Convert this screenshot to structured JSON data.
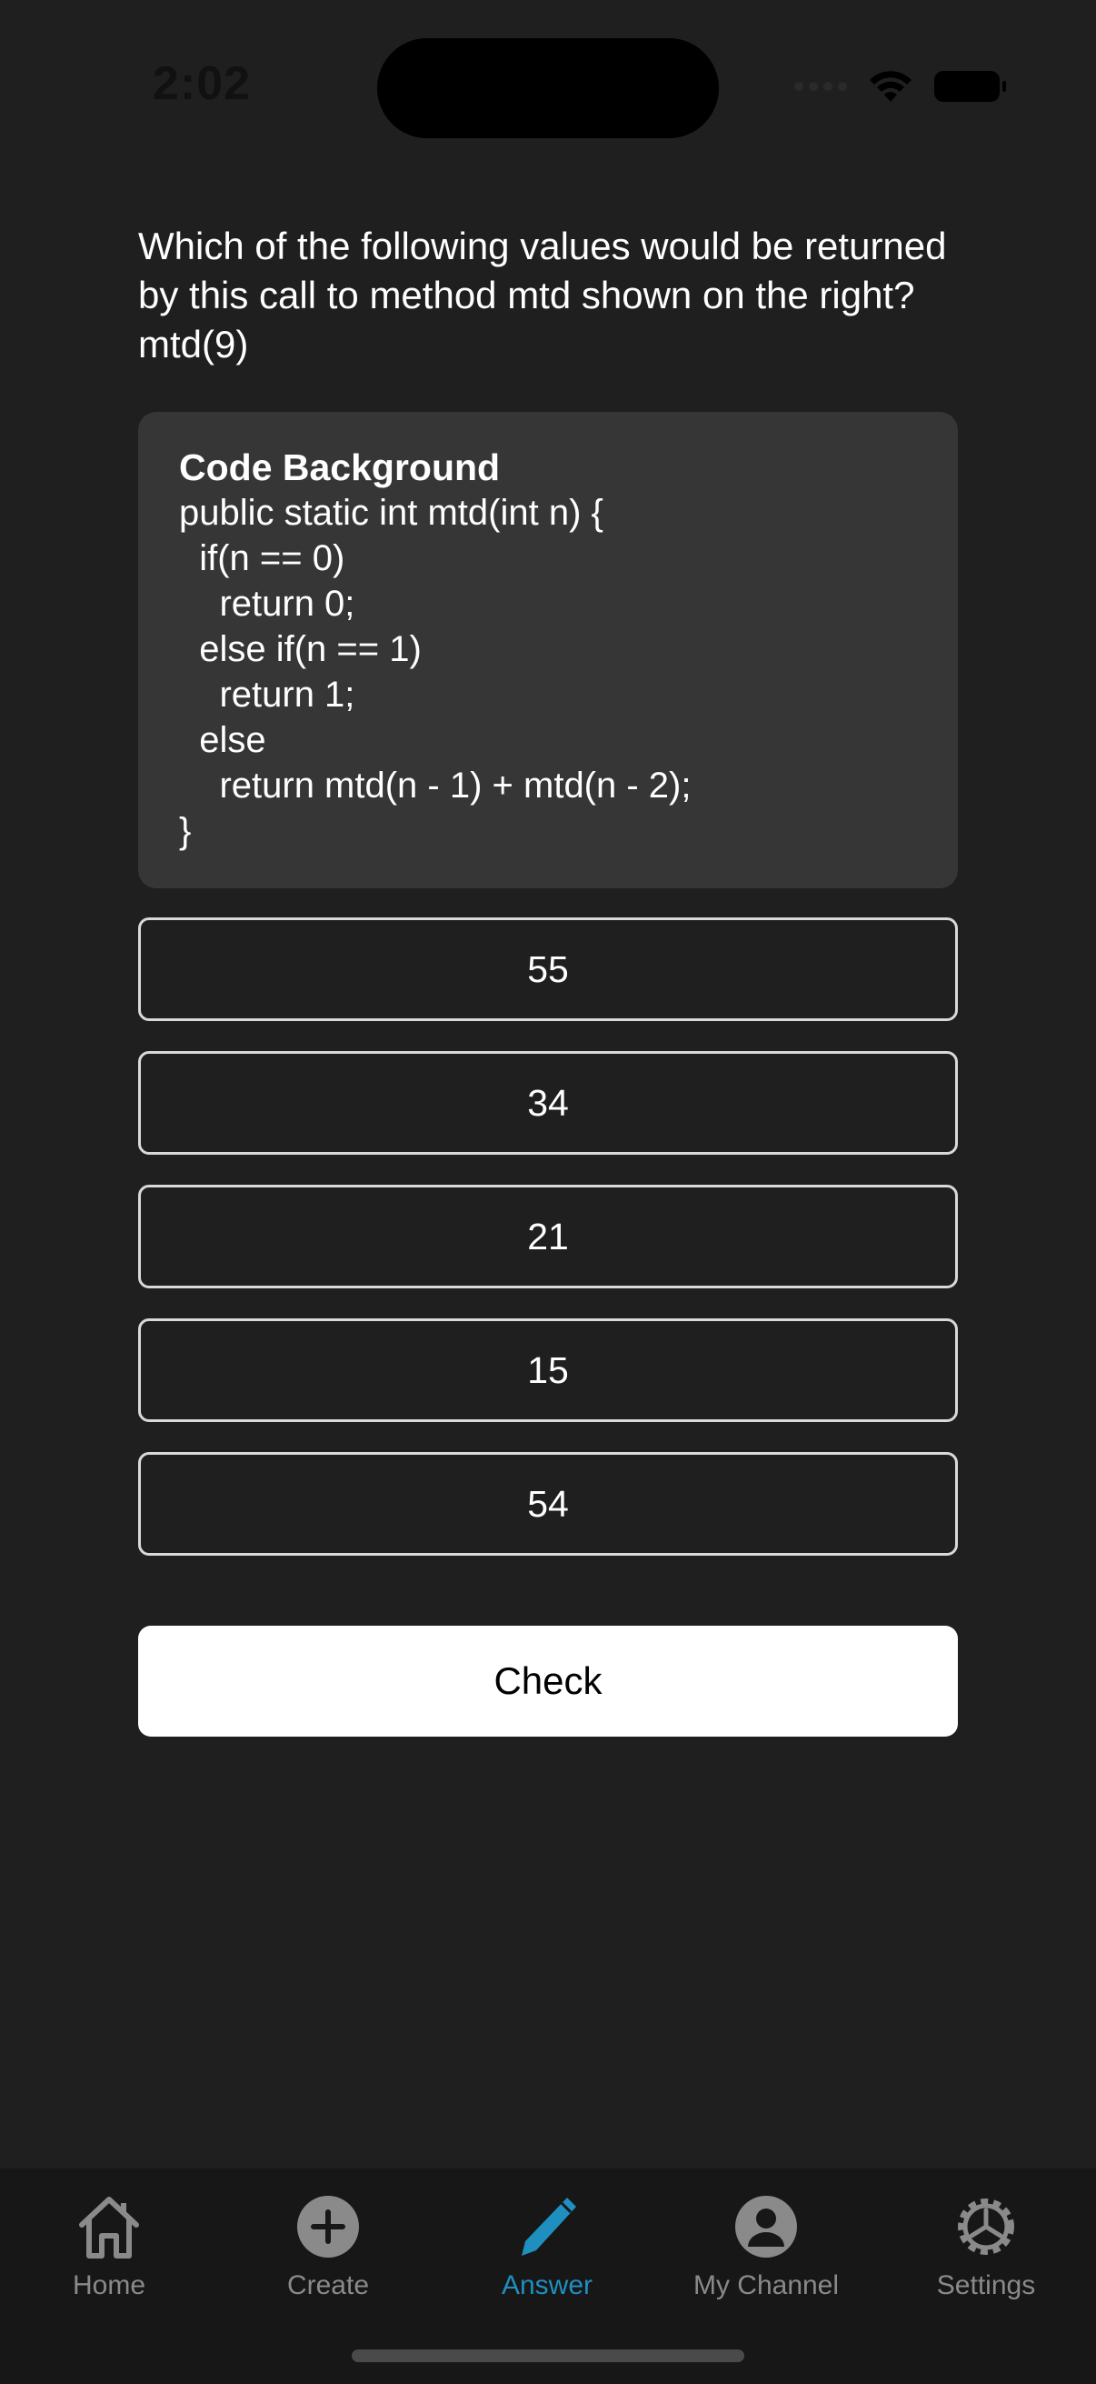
{
  "status_bar": {
    "time": "2:02"
  },
  "question": {
    "text": "Which of the following values would be returned by this call to method mtd shown on the right? mtd(9)"
  },
  "code_background": {
    "title": "Code Background",
    "lines": [
      "public static int mtd(int n) {",
      "  if(n == 0)",
      "    return 0;",
      "  else if(n == 1)",
      "    return 1;",
      "  else",
      "    return mtd(n - 1) + mtd(n - 2);",
      "}"
    ]
  },
  "options": [
    "55",
    "34",
    "21",
    "15",
    "54"
  ],
  "check_button": {
    "label": "Check"
  },
  "tab_bar": {
    "items": [
      {
        "label": "Home",
        "icon": "home-icon",
        "active": false
      },
      {
        "label": "Create",
        "icon": "plus-circle-icon",
        "active": false
      },
      {
        "label": "Answer",
        "icon": "pen-icon",
        "active": true
      },
      {
        "label": "My Channel",
        "icon": "person-circle-icon",
        "active": false
      },
      {
        "label": "Settings",
        "icon": "gear-icon",
        "active": false
      }
    ],
    "active_color": "#1f8fc0",
    "inactive_color": "#8a8a8a"
  }
}
